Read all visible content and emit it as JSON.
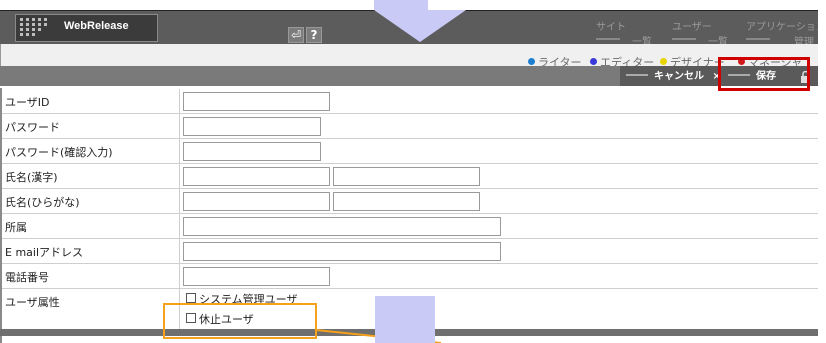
{
  "app": {
    "title": "WebRelease"
  },
  "header": {
    "back_icon": "return-icon",
    "help_label": "?",
    "menus": [
      {
        "title": "サイト",
        "sub": "一覧"
      },
      {
        "title": "ユーザー",
        "sub": "一覧"
      },
      {
        "title": "アプリケーション",
        "sub": "管理"
      }
    ]
  },
  "legend": [
    {
      "label": "ライター",
      "color": "#1e7fd0"
    },
    {
      "label": "エディター",
      "color": "#3a3ad8"
    },
    {
      "label": "デザイナー",
      "color": "#e8d400"
    },
    {
      "label": "マネージャ",
      "color": "#d01818"
    }
  ],
  "actions": {
    "cancel_label": "キャンセル",
    "cancel_icon": "×",
    "save_label": "保存",
    "save_icon": "lock-icon"
  },
  "form": {
    "user_id_label": "ユーザID",
    "password_label": "パスワード",
    "password_confirm_label": "パスワード(確認入力)",
    "name_kanji_label": "氏名(漢字)",
    "name_kana_label": "氏名(ひらがな)",
    "affiliation_label": "所属",
    "email_label": "E mailアドレス",
    "phone_label": "電話番号",
    "attributes_label": "ユーザ属性",
    "attr_admin_label": "システム管理ユーザ",
    "attr_suspended_label": "休止ユーザ"
  },
  "annotation_colors": {
    "save_highlight": "#d00000",
    "checkbox_highlight": "#f5a11c",
    "pointer_fill": "#c9caf5"
  }
}
